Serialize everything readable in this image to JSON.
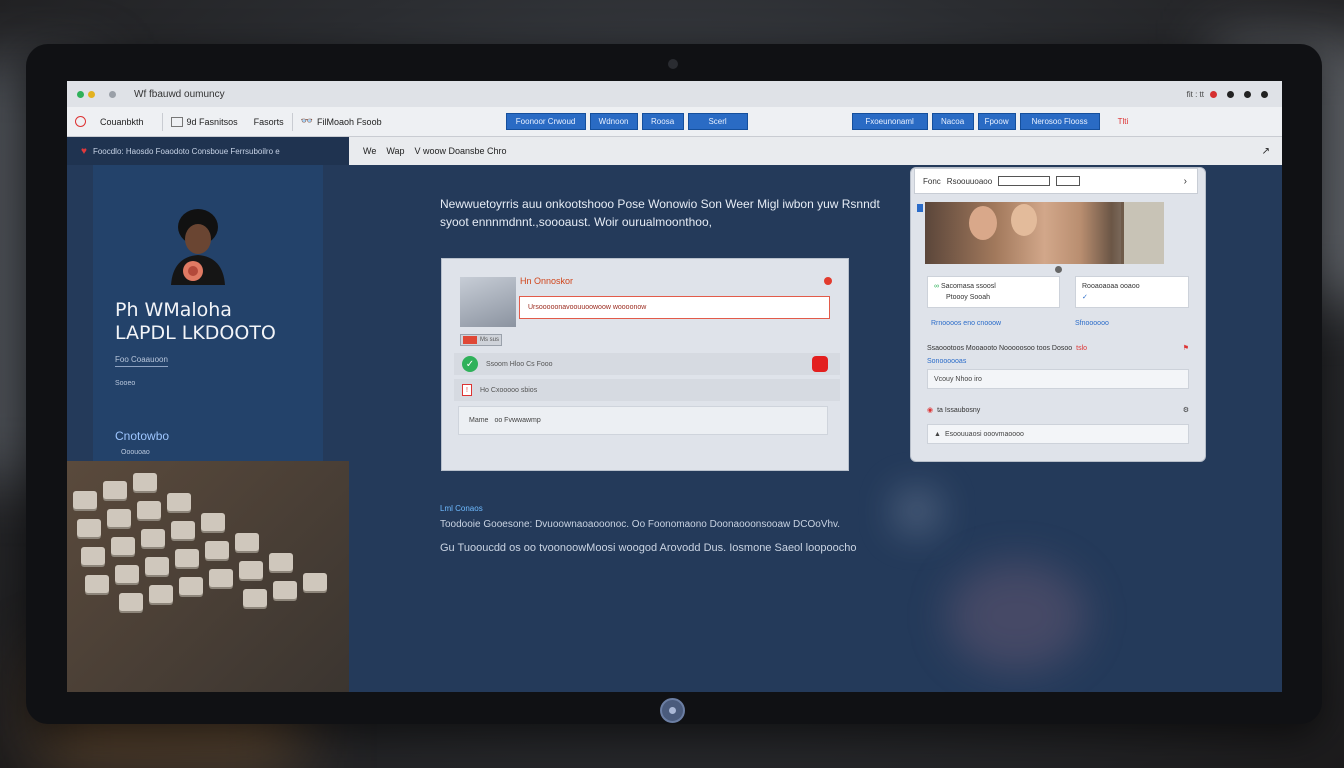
{
  "window": {
    "title": "Wf fbauwd oumuncy",
    "right_label": "fit : tt"
  },
  "toolbar": {
    "app_label": "Couanbkth",
    "item1": "9d Fasnitsos",
    "item2": "Fasorts",
    "item3": "FilMoaoh Fsoob",
    "buttons_left": [
      "Foonoor Crwoud",
      "Wdnoon",
      "Roosa",
      "Scerl"
    ],
    "buttons_right": [
      "Fxoeunonaml",
      "Nacoa",
      "Fpoow",
      "Nerosoo Flooss"
    ],
    "right_red": "Tlti"
  },
  "sidebar": {
    "header": "Foocdlo: Haosdo  Foaodoto Consboue Ferrsuboilro  e",
    "profile": {
      "name_line1": "Ph WMaloha",
      "name_line2": "LAPDL LKDOOTO",
      "role": "Foo Coaauoon",
      "meta": "Sooeo",
      "link": "Cnotowbo",
      "sub": "Ooouoao"
    }
  },
  "main": {
    "header_a": "We",
    "header_b": "Wap",
    "header_c": "V woow Doansbe Chro",
    "intro": "Newwuetoyrris auu onkootshooo Pose Wonowio Son Weer Migl iwbon yuw Rsnndt syoot ennnmdnnt.,soooaust. Woir ourualmoonthoo,",
    "dialog": {
      "title": "Hn Onnoskor",
      "input_value": "Ursooooonavoouuoowoow woooonow",
      "tag": "Ms sus",
      "row1": "Ssoom  Hloo Cs  Fooo",
      "row2": "Ho Cxooooo sbios",
      "footer_a": "Mame",
      "footer_b": "oo  Fvwwawmp"
    },
    "info": {
      "title": "Lml Conaos",
      "line1": "Toodooie Gooesone: Dvuoownaoaooonoc. Oo Foonomaono Doonaooonsooaw DCOoVhv.",
      "line2": "Gu Tuooucdd os oo tvoonoowMoosi woogod Arovodd  Dus. Iosmone Saeol loopoocho"
    }
  },
  "right_panel": {
    "search_label": "Fonc",
    "search_title": "Rsoouuoaoo",
    "card1_line1": "Sacomasa ssoosl",
    "card1_line2": "Ptoooy Sooah",
    "card2_line1": "Rooaoaoaa ooaoo",
    "label1": "Rrnoooos eno cnooow",
    "label2": "Sfnoooooo",
    "row1_label": "Ssaoootoos Mooaooto Nooooosoo toos Dosoo",
    "row1_red": "tslo",
    "row2_label": "Sonoooooas",
    "field1": "Vcouy Nhoo iro",
    "row3_label": "ta Issaubosny",
    "field2": "Esoouuaosi ooovmaoooo"
  }
}
